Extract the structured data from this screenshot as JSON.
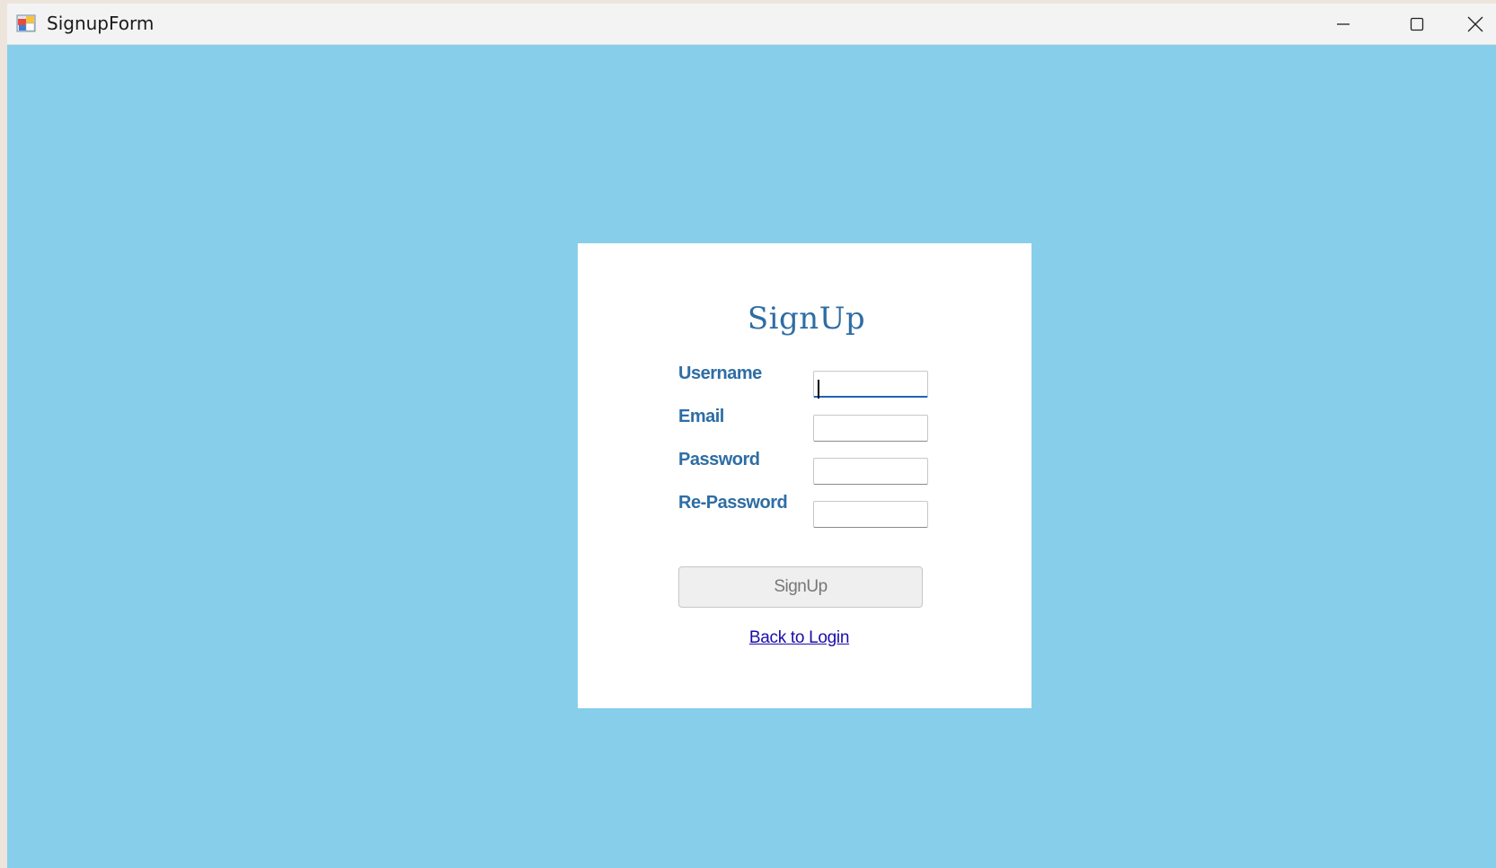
{
  "window": {
    "title": "SignupForm",
    "controls": {
      "minimize": "minimize-icon",
      "maximize": "maximize-icon",
      "close": "close-icon"
    }
  },
  "form": {
    "title": "SignUp",
    "fields": [
      {
        "label": "Username",
        "value": "",
        "focused": true
      },
      {
        "label": "Email",
        "value": ""
      },
      {
        "label": "Password",
        "value": ""
      },
      {
        "label": "Re-Password",
        "value": ""
      }
    ],
    "submit_label": "SignUp",
    "back_link": "Back to Login"
  },
  "colors": {
    "background": "#87ceeb",
    "panel": "#ffffff",
    "label": "#2e6da4",
    "link": "#1a0dab"
  }
}
